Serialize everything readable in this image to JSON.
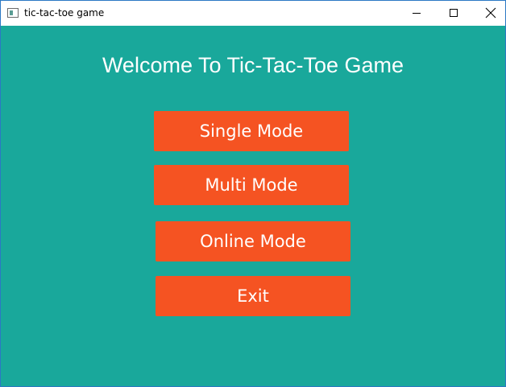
{
  "window": {
    "title": "tic-tac-toe game",
    "icon": "app-window-icon",
    "controls": [
      "minimize-icon",
      "maximize-icon",
      "close-icon"
    ]
  },
  "main": {
    "heading": "Welcome To Tic-Tac-Toe Game",
    "buttons": [
      {
        "label": "Single Mode"
      },
      {
        "label": "Multi Mode"
      },
      {
        "label": "Online Mode"
      },
      {
        "label": "Exit"
      }
    ]
  },
  "colors": {
    "background": "#19a89b",
    "button": "#f55322",
    "text": "#ffffff"
  }
}
